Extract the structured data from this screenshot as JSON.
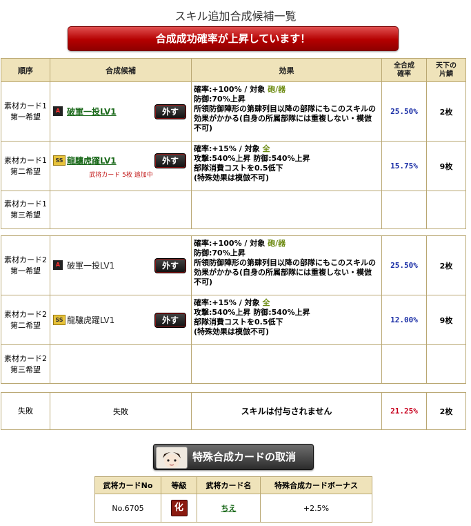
{
  "title": "スキル追加合成候補一覧",
  "banner": "合成成功確率が上昇しています！",
  "headers": {
    "order": "順序",
    "candidate": "合成候補",
    "effect": "効果",
    "rate": "全合成確率",
    "card": "天下の片鱗"
  },
  "group1": [
    {
      "order1": "素材カード1",
      "order2": "第一希望",
      "badge": "A",
      "skill": "破軍一投LV1",
      "remove": "外す",
      "eff1a": "確率:+100% / 対象 ",
      "eff1b": "砲/器",
      "eff2": "防御:70%上昇",
      "eff3": "所領防御陣形の第肆列目以降の部隊にもこのスキルの効果がかかる(自身の所属部隊には重複しない・模倣不可)",
      "rate": "25.50%",
      "card": "2枚"
    },
    {
      "order1": "素材カード1",
      "order2": "第二希望",
      "badge": "SS",
      "skill": "龍驤虎躍LV1",
      "remove": "外す",
      "note": "武将カード 5枚 追加中",
      "eff1a": "確率:+15% / 対象 ",
      "eff1b": "全",
      "eff2": "攻撃:540%上昇 防御:540%上昇",
      "eff3": "部隊消費コストを0.5低下",
      "eff4": "(特殊効果は模倣不可)",
      "rate": "15.75%",
      "card": "9枚"
    },
    {
      "order1": "素材カード1",
      "order2": "第三希望"
    }
  ],
  "group2": [
    {
      "order1": "素材カード2",
      "order2": "第一希望",
      "badge": "A",
      "skill": "破軍一投LV1",
      "remove": "外す",
      "eff1a": "確率:+100% / 対象 ",
      "eff1b": "砲/器",
      "eff2": "防御:70%上昇",
      "eff3": "所領防御陣形の第肆列目以降の部隊にもこのスキルの効果がかかる(自身の所属部隊には重複しない・模倣不可)",
      "rate": "25.50%",
      "card": "2枚"
    },
    {
      "order1": "素材カード2",
      "order2": "第二希望",
      "badge": "SS",
      "skill": "龍驤虎躍LV1",
      "remove": "外す",
      "eff1a": "確率:+15% / 対象 ",
      "eff1b": "全",
      "eff2": "攻撃:540%上昇 防御:540%上昇",
      "eff3": "部隊消費コストを0.5低下",
      "eff4": "(特殊効果は模倣不可)",
      "rate": "12.00%",
      "card": "9枚"
    },
    {
      "order1": "素材カード2",
      "order2": "第三希望"
    }
  ],
  "fail": {
    "order": "失敗",
    "cand": "失敗",
    "effect": "スキルは付与されません",
    "rate": "21.25%",
    "card": "2枚"
  },
  "cancel_button": "特殊合成カードの取消",
  "special": {
    "headers": {
      "no": "武将カードNo",
      "rank": "等級",
      "name": "武将カード名",
      "bonus": "特殊合成カードボーナス"
    },
    "no": "No.6705",
    "rank": "化",
    "name": "ちえ",
    "bonus": "+2.5%"
  }
}
